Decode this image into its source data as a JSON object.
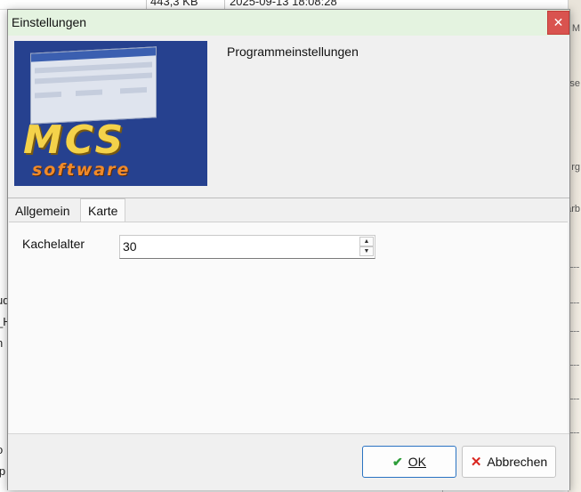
{
  "background": {
    "size_cell": "443,3 KB",
    "date_cell": "2025-09-13 18:08:28",
    "left_fragments": [
      "ud",
      "_H",
      "n",
      "o",
      "ip"
    ],
    "map_fragments": [
      "M",
      "se",
      "rg",
      "arb"
    ]
  },
  "dialog": {
    "title": "Einstellungen",
    "close_symbol": "✕",
    "header_label": "Programmeinstellungen",
    "logo": {
      "text_main": "MCS",
      "text_sub": "software"
    },
    "tabs": [
      {
        "label": "Allgemein",
        "active": false
      },
      {
        "label": "Karte",
        "active": true
      }
    ],
    "karte": {
      "field_label": "Kachelalter",
      "field_value": "30"
    },
    "buttons": {
      "ok_label": "OK",
      "ok_icon": "check-icon",
      "cancel_label": "Abbrechen",
      "cancel_icon": "x-icon"
    },
    "colors": {
      "titlebar": "#e4f3e0",
      "close": "#d9534f",
      "logo_bg": "#26418f",
      "logo_text": "#f4d24a",
      "logo_sub": "#f08a2a",
      "ok_border": "#2a73c2"
    }
  }
}
